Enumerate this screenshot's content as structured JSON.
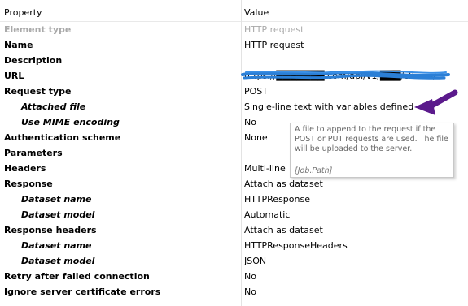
{
  "header": {
    "property": "Property",
    "value": "Value"
  },
  "rows": [
    {
      "property": "Element type",
      "value": "HTTP request"
    },
    {
      "property": "Name",
      "value": "HTTP request"
    },
    {
      "property": "Description",
      "value": ""
    },
    {
      "property": "URL",
      "value": "https://███████.com/api/v1/███/clients/"
    },
    {
      "property": "Request type",
      "value": "POST"
    },
    {
      "property": "Attached file",
      "value": "Single-line text with variables defined"
    },
    {
      "property": "Use MIME encoding",
      "value": "No"
    },
    {
      "property": "Authentication scheme",
      "value": "None"
    },
    {
      "property": "Parameters",
      "value": ""
    },
    {
      "property": "Headers",
      "value": "Multi-line"
    },
    {
      "property": "Response",
      "value": "Attach as dataset"
    },
    {
      "property": "Dataset name",
      "value": "HTTPResponse"
    },
    {
      "property": "Dataset model",
      "value": "Automatic"
    },
    {
      "property": "Response headers",
      "value": "Attach as dataset"
    },
    {
      "property": "Dataset name",
      "value": "HTTPResponseHeaders"
    },
    {
      "property": "Dataset model",
      "value": "JSON"
    },
    {
      "property": "Retry after failed connection",
      "value": "No"
    },
    {
      "property": "Ignore server certificate errors",
      "value": "No"
    }
  ],
  "tooltip": {
    "text": "A file to append to the request if the POST or PUT requests are used. The file will be uploaded to the server.",
    "variable": "[Job.Path]"
  },
  "colors": {
    "annotation": "#5b1a8c",
    "scribble": "#2b7fd6",
    "disabled_text": "#a9a9a9"
  },
  "icons": {
    "annotation_arrow": "arrow-icon"
  }
}
